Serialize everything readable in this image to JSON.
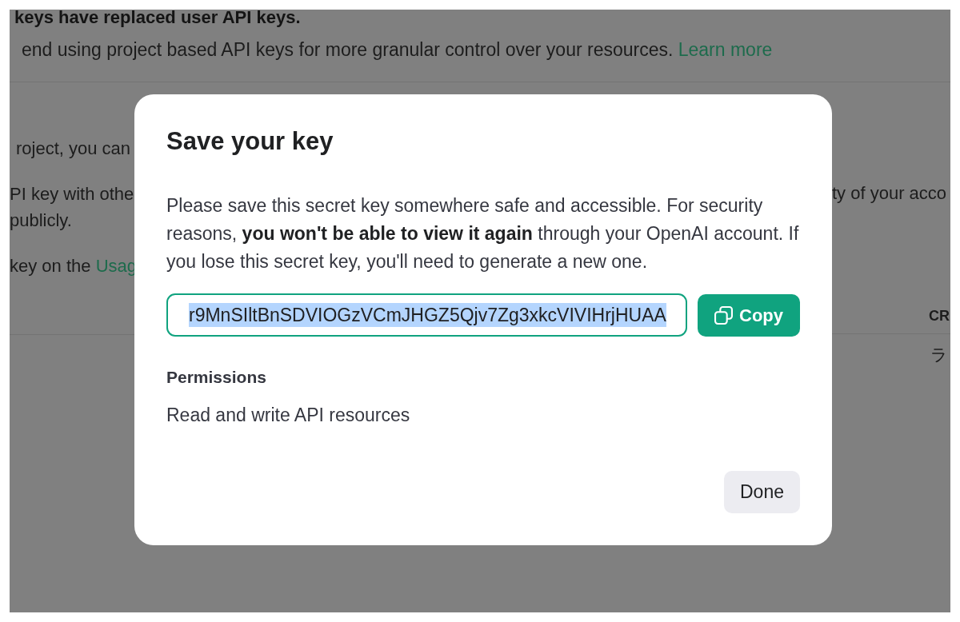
{
  "background": {
    "banner": {
      "title": "keys have replaced user API keys.",
      "text": "end using project based API keys for more granular control over your resources.",
      "link": "Learn more"
    },
    "left_paragraphs": [
      {
        "lines": [
          "roject, you can"
        ]
      },
      {
        "lines": [
          "PI key with othe",
          "publicly."
        ]
      },
      {
        "lines": [
          "key on the"
        ],
        "link": "Usag"
      }
    ],
    "right_lines": [
      "ty of your acco"
    ],
    "table": {
      "columns": [
        "CR"
      ],
      "rows": [
        [
          "ラ"
        ]
      ]
    }
  },
  "dialog": {
    "title": "Save your key",
    "message": "Please save this secret key somewhere safe and accessible. For security reasons, **you won't be able to view it again** through your OpenAI account. If you lose this secret key, you'll need to generate a new one.",
    "key_field": {
      "value": "r9MnSIltBnSDVIOGzVCmJHGZ5Qjv7Zg3xkcVIVIHrjHUAA",
      "text_selected": true
    },
    "copy_button": "Copy",
    "permissions_label": "Permissions",
    "permissions_value": "Read and write API resources",
    "done_button": "Done"
  }
}
